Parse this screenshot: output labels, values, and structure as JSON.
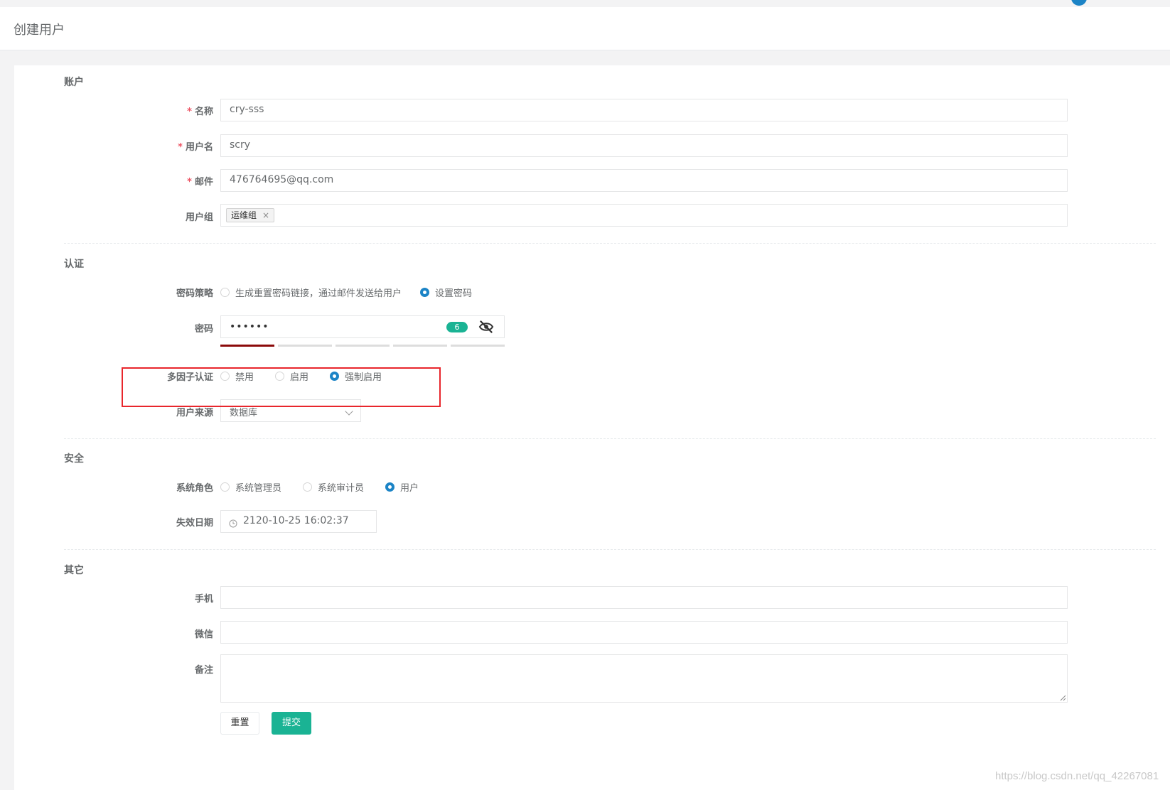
{
  "header": {
    "title": "创建用户"
  },
  "sections": {
    "account": {
      "title": "账户",
      "name_label": "名称",
      "name_value": "cry-sss",
      "username_label": "用户名",
      "username_value": "scry",
      "email_label": "邮件",
      "email_value": "476764695@qq.com",
      "group_label": "用户组",
      "group_tags": [
        "运维组"
      ],
      "required_mark": "*"
    },
    "auth": {
      "title": "认证",
      "password_policy_label": "密码策略",
      "password_policy_options": [
        "生成重置密码链接，通过邮件发送给用户",
        "设置密码"
      ],
      "password_policy_selected": 1,
      "password_label": "密码",
      "password_masked": "••••••",
      "password_length": "6",
      "password_strength": 0.2,
      "mfa_label": "多因子认证",
      "mfa_options": [
        "禁用",
        "启用",
        "强制启用"
      ],
      "mfa_selected": 2,
      "source_label": "用户来源",
      "source_value": "数据库"
    },
    "security": {
      "title": "安全",
      "role_label": "系统角色",
      "role_options": [
        "系统管理员",
        "系统审计员",
        "用户"
      ],
      "role_selected": 2,
      "expire_label": "失效日期",
      "expire_value": "2120-10-25 16:02:37"
    },
    "other": {
      "title": "其它",
      "phone_label": "手机",
      "phone_value": "",
      "wechat_label": "微信",
      "wechat_value": "",
      "comment_label": "备注",
      "comment_value": ""
    }
  },
  "buttons": {
    "reset": "重置",
    "submit": "提交"
  },
  "watermark": "https://blog.csdn.net/qq_42267081",
  "colors": {
    "primary": "#1ab394",
    "accent": "#1c84c6",
    "required": "#ed5565",
    "highlight": "#e8262c",
    "strength_fill": "#8b0a0a"
  }
}
